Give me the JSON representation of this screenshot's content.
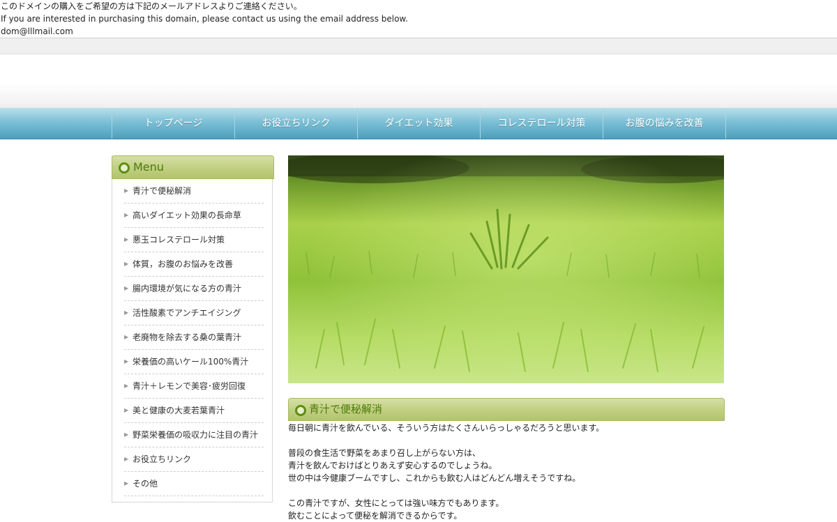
{
  "notice": {
    "line_ja": "このドメインの購入をご希望の方は下記のメールアドレスよりご連絡ください。",
    "line_en": "If you are interested in purchasing this domain, please contact us using the email address below.",
    "email": "dom@lllmail.com"
  },
  "nav": {
    "items": [
      {
        "label": "トップページ"
      },
      {
        "label": "お役立ちリンク"
      },
      {
        "label": "ダイエット効果"
      },
      {
        "label": "コレステロール対策"
      },
      {
        "label": "お腹の悩みを改善"
      }
    ]
  },
  "sidebar": {
    "title": "Menu",
    "items": [
      {
        "label": "青汁で便秘解消"
      },
      {
        "label": "高いダイエット効果の長命草"
      },
      {
        "label": "悪玉コレステロール対策"
      },
      {
        "label": "体質，お腹のお悩みを改善"
      },
      {
        "label": "腸内環境が気になる方の青汁"
      },
      {
        "label": "活性酸素でアンチエイジング"
      },
      {
        "label": "老廃物を除去する桑の葉青汁"
      },
      {
        "label": "栄養価の高いケール100%青汁"
      },
      {
        "label": "青汁＋レモンで美容･疲労回復"
      },
      {
        "label": "美と健康の大麦若葉青汁"
      },
      {
        "label": "野菜栄養価の吸収力に注目の青汁"
      },
      {
        "label": "お役立ちリンク"
      },
      {
        "label": "その他"
      }
    ]
  },
  "article": {
    "title": "青汁で便秘解消",
    "lines": [
      "毎日朝に青汁を飲んでいる、そういう方はたくさんいらっしゃるだろうと思います。",
      "",
      "普段の食生活で野菜をあまり召し上がらない方は、",
      "青汁を飲んでおけばとりあえず安心するのでしょうね。",
      "世の中は今健康ブームですし、これからも飲む人はどんどん増えそうですね。",
      "",
      "この青汁ですが、女性にとっては強い味方でもあります。",
      "飲むことによって便秘を解消できるからです。"
    ]
  },
  "colors": {
    "nav_top": "#b9e0ea",
    "nav_bottom": "#4c9fbe",
    "heading_green": "#c2d083",
    "heading_text": "#4d7a0a"
  }
}
